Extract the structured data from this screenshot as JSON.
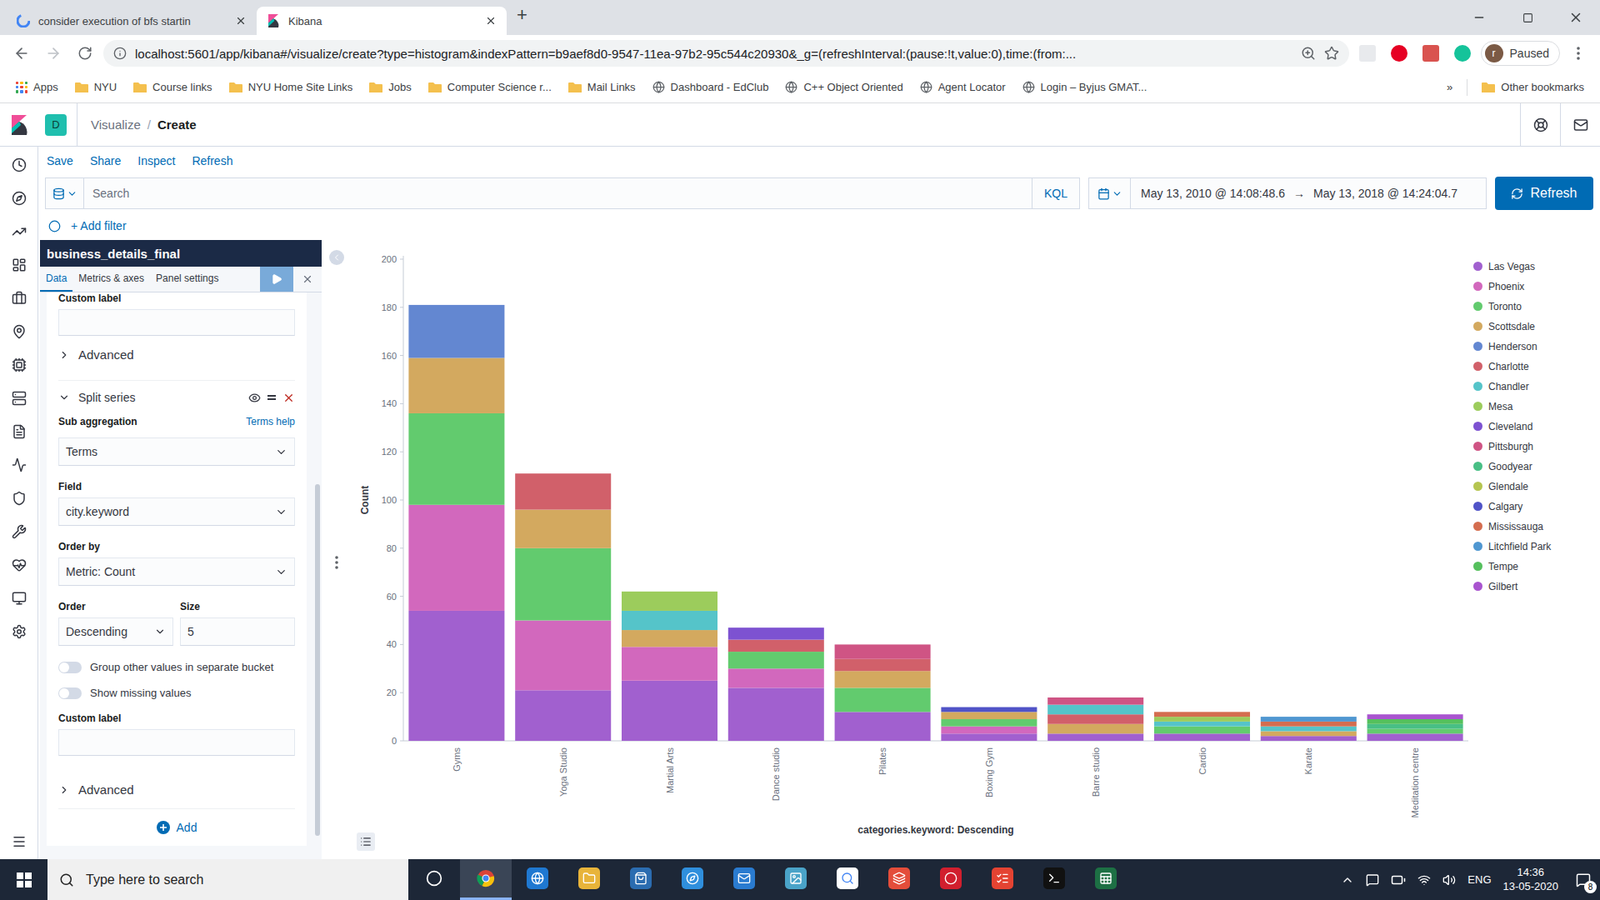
{
  "browser": {
    "tabs": [
      {
        "title": "consider execution of bfs startin",
        "selected": false
      },
      {
        "title": "Kibana",
        "selected": true
      }
    ],
    "new_tab": "+",
    "address": "localhost:5601/app/kibana#/visualize/create?type=histogram&indexPattern=b9aef8d0-9547-11ea-97b2-95c544c20930&_g=(refreshInterval:(pause:!t,value:0),time:(from:...",
    "profile": {
      "initial": "r",
      "status": "Paused"
    },
    "bookmarks": [
      {
        "label": "Apps",
        "kind": "apps"
      },
      {
        "label": "NYU",
        "kind": "folder"
      },
      {
        "label": "Course links",
        "kind": "folder"
      },
      {
        "label": "NYU Home Site Links",
        "kind": "folder"
      },
      {
        "label": "Jobs",
        "kind": "folder"
      },
      {
        "label": "Computer Science r...",
        "kind": "folder"
      },
      {
        "label": "Mail Links",
        "kind": "folder"
      },
      {
        "label": "Dashboard - EdClub",
        "kind": "site"
      },
      {
        "label": "C++ Object Oriented",
        "kind": "site"
      },
      {
        "label": "Agent Locator",
        "kind": "site"
      },
      {
        "label": "Login – Byjus GMAT...",
        "kind": "site"
      }
    ],
    "more": "»",
    "other_bookmarks": "Other bookmarks"
  },
  "kibana": {
    "space": "D",
    "breadcrumbs": [
      "Visualize",
      "Create"
    ],
    "breadcrumb_separator": "/",
    "top_menu": [
      "Save",
      "Share",
      "Inspect",
      "Refresh"
    ],
    "query": {
      "placeholder": "Search",
      "language": "KQL"
    },
    "time_range": {
      "from": "May 13, 2010 @ 14:08:48.6",
      "arrow": "→",
      "to": "May 13, 2018 @ 14:24:04.7"
    },
    "refresh_button": "Refresh",
    "add_filter": "+ Add filter"
  },
  "editor": {
    "index_pattern": "business_details_final",
    "tabs": [
      {
        "label": "Data",
        "selected": true
      },
      {
        "label": "Metrics & axes",
        "selected": false
      },
      {
        "label": "Panel settings",
        "selected": false
      }
    ],
    "top_label": "Custom label",
    "top_advanced": "Advanced",
    "split": {
      "title": "Split series",
      "expanded": true,
      "sub_aggregation_label": "Sub aggregation",
      "help_link": "Terms help",
      "aggregation": "Terms",
      "field_label": "Field",
      "field": "city.keyword",
      "order_by_label": "Order by",
      "order_by": "Metric: Count",
      "order_label": "Order",
      "order": "Descending",
      "size_label": "Size",
      "size": "5",
      "toggles": [
        {
          "label": "Group other values in separate bucket",
          "on": false
        },
        {
          "label": "Show missing values",
          "on": false
        }
      ],
      "custom_label": "Custom label",
      "advanced": "Advanced"
    },
    "add_button": "Add"
  },
  "chart": {
    "y_axis_title": "Count",
    "x_axis_title": "categories.keyword: Descending",
    "y_ticks": [
      "0",
      "20",
      "40",
      "60",
      "80",
      "100",
      "120",
      "140",
      "160",
      "180",
      "200"
    ],
    "categories": [
      "Gyms",
      "Yoga Studio",
      "Martial Arts",
      "Dance studio",
      "Pilates",
      "Boxing Gym",
      "Barre studio",
      "Cardio",
      "Karate",
      "Meditation centre"
    ],
    "series": [
      {
        "name": "Las Vegas",
        "color": "#a160cf",
        "values": [
          54,
          21,
          25,
          22,
          12,
          3,
          3,
          3,
          2,
          3
        ]
      },
      {
        "name": "Phoenix",
        "color": "#d268bd",
        "values": [
          44,
          29,
          14,
          8,
          0,
          3,
          0,
          0,
          0,
          0
        ]
      },
      {
        "name": "Toronto",
        "color": "#62cb6e",
        "values": [
          38,
          30,
          0,
          7,
          10,
          3,
          0,
          3,
          0,
          2
        ]
      },
      {
        "name": "Scottsdale",
        "color": "#d3a95f",
        "values": [
          23,
          16,
          7,
          0,
          7,
          3,
          4,
          0,
          2,
          0
        ]
      },
      {
        "name": "Henderson",
        "color": "#6387d1",
        "values": [
          22,
          0,
          0,
          0,
          0,
          0,
          0,
          0,
          0,
          0
        ]
      },
      {
        "name": "Charlotte",
        "color": "#d1606a",
        "values": [
          0,
          15,
          0,
          5,
          5,
          0,
          4,
          0,
          0,
          0
        ]
      },
      {
        "name": "Chandler",
        "color": "#55c4c9",
        "values": [
          0,
          0,
          8,
          0,
          0,
          0,
          4,
          2,
          2,
          0
        ]
      },
      {
        "name": "Mesa",
        "color": "#9ccc5c",
        "values": [
          0,
          0,
          8,
          0,
          0,
          0,
          0,
          2,
          0,
          0
        ]
      },
      {
        "name": "Cleveland",
        "color": "#7d52d1",
        "values": [
          0,
          0,
          0,
          5,
          0,
          0,
          0,
          0,
          0,
          0
        ]
      },
      {
        "name": "Pittsburgh",
        "color": "#cf5484",
        "values": [
          0,
          0,
          0,
          0,
          6,
          0,
          3,
          0,
          0,
          0
        ]
      },
      {
        "name": "Goodyear",
        "color": "#48bf85",
        "values": [
          0,
          0,
          0,
          0,
          0,
          0,
          0,
          0,
          0,
          2
        ]
      },
      {
        "name": "Glendale",
        "color": "#b5c550",
        "values": [
          0,
          0,
          0,
          0,
          0,
          0,
          0,
          0,
          0,
          0
        ]
      },
      {
        "name": "Calgary",
        "color": "#5053c7",
        "values": [
          0,
          0,
          0,
          0,
          0,
          2,
          0,
          0,
          0,
          0
        ]
      },
      {
        "name": "Mississauga",
        "color": "#d46d4f",
        "values": [
          0,
          0,
          0,
          0,
          0,
          0,
          0,
          2,
          2,
          0
        ]
      },
      {
        "name": "Litchfield Park",
        "color": "#4f97d1",
        "values": [
          0,
          0,
          0,
          0,
          0,
          0,
          0,
          0,
          2,
          0
        ]
      },
      {
        "name": "Tempe",
        "color": "#55c05d",
        "values": [
          0,
          0,
          0,
          0,
          0,
          0,
          0,
          0,
          0,
          2
        ]
      },
      {
        "name": "Gilbert",
        "color": "#a954cf",
        "values": [
          0,
          0,
          0,
          0,
          0,
          0,
          0,
          0,
          0,
          2
        ]
      }
    ]
  },
  "taskbar": {
    "search_placeholder": "Type here to search",
    "language": "ENG",
    "time": "14:36",
    "date": "13-05-2020",
    "notifications": "8"
  }
}
